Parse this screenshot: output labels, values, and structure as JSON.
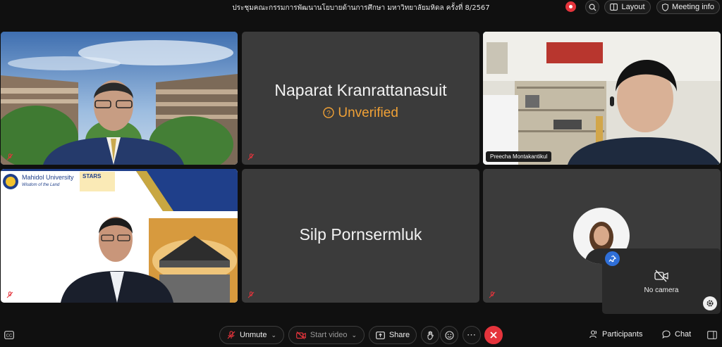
{
  "header": {
    "meeting_title": "ประชุมคณะกรรมการพัฒนานโยบายด้านการศึกษา มหาวิทยาลัยมหิดล ครั้งที่ 8/2567",
    "layout_label": "Layout",
    "meeting_info_label": "Meeting info"
  },
  "tiles": {
    "t2": {
      "name": "Naparat Kranrattanasuit",
      "status": "Unverified"
    },
    "t3": {
      "name_tag": "Preecha Montakantikul"
    },
    "t4": {
      "logo_university": "Mahidol University",
      "logo_tagline": "Wisdom of the Land",
      "logo_stars": "STARS"
    },
    "t5": {
      "name": "Silp Pornsermluk"
    }
  },
  "self_view": {
    "no_camera_label": "No camera"
  },
  "toolbar": {
    "unmute_label": "Unmute",
    "start_video_label": "Start video",
    "share_label": "Share",
    "participants_label": "Participants",
    "chat_label": "Chat"
  },
  "colors": {
    "accent_orange": "#f0a136",
    "end_red": "#e5343c",
    "active_border": "#3fb8c8"
  }
}
